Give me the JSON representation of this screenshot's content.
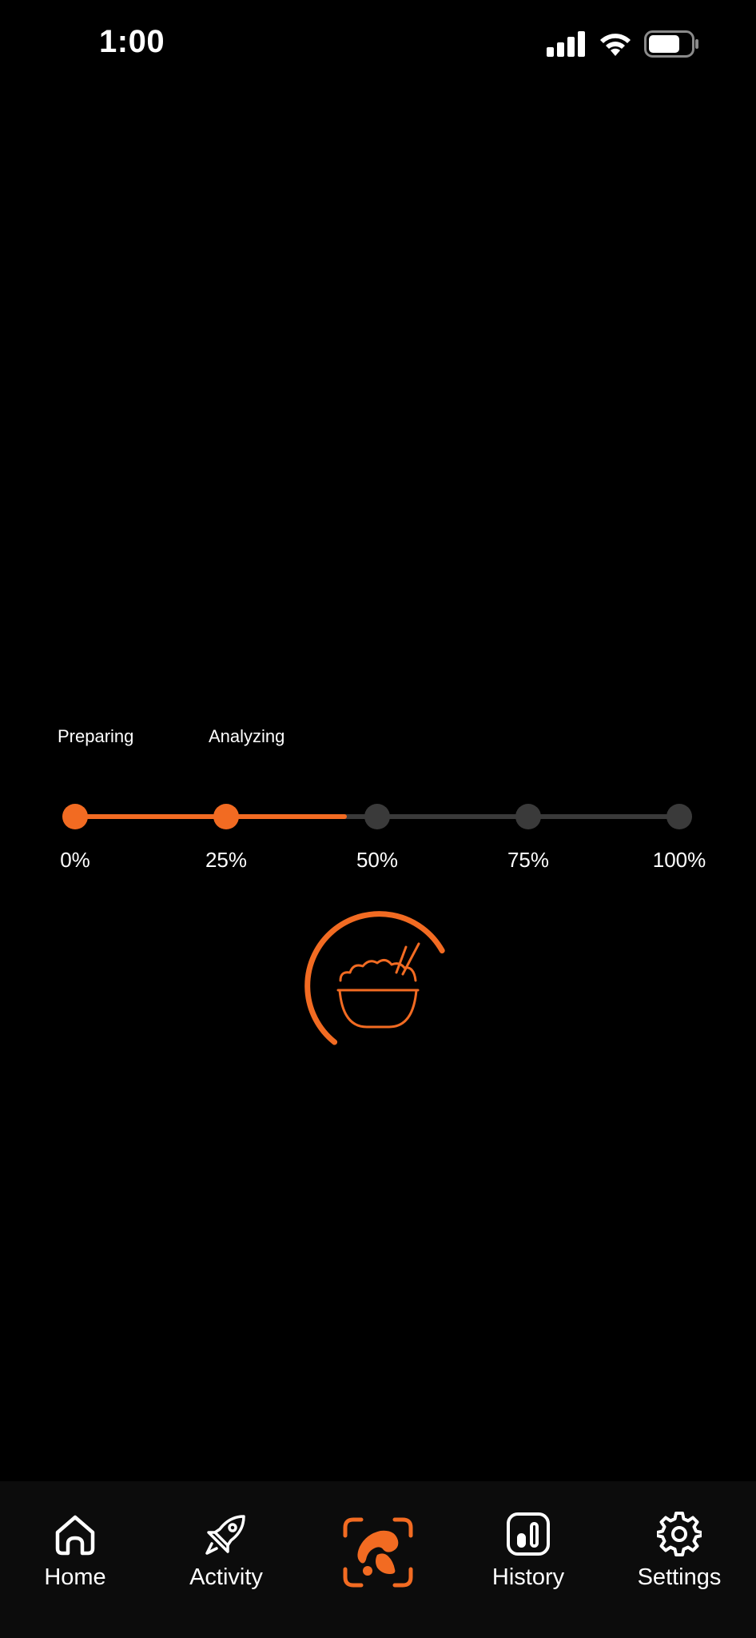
{
  "status_bar": {
    "time": "1:00",
    "icons": [
      "cellular-signal-icon",
      "wifi-icon",
      "battery-icon"
    ]
  },
  "progress": {
    "stages": [
      "Preparing",
      "Analyzing"
    ],
    "steps": [
      "0%",
      "25%",
      "50%",
      "75%",
      "100%"
    ],
    "value_percent": 45,
    "completed_steps": 2
  },
  "loader": {
    "icon": "rice-bowl-icon"
  },
  "tab_bar": {
    "tabs": [
      {
        "label": "Home",
        "icon": "home-icon"
      },
      {
        "label": "Activity",
        "icon": "rocket-icon"
      },
      {
        "label": "",
        "icon": "food-scan-icon"
      },
      {
        "label": "History",
        "icon": "bar-chart-icon"
      },
      {
        "label": "Settings",
        "icon": "gear-icon"
      }
    ]
  },
  "colors": {
    "accent": "#f26b22",
    "inactive": "#3a3a3a",
    "background": "#000000",
    "tab_bar_background": "#0c0c0c"
  }
}
